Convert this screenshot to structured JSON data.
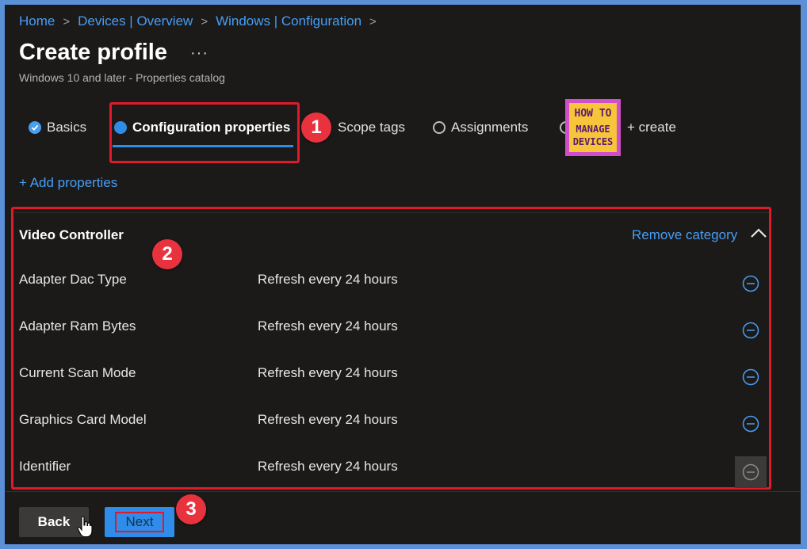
{
  "breadcrumb": {
    "items": [
      "Home",
      "Devices | Overview",
      "Windows | Configuration"
    ],
    "separator": ">"
  },
  "header": {
    "title": "Create profile",
    "more": "···",
    "subtitle": "Windows 10 and later - Properties catalog"
  },
  "wizard": {
    "steps": [
      {
        "label": "Basics",
        "state": "completed"
      },
      {
        "label": "Configuration properties",
        "state": "active"
      },
      {
        "label": "Scope tags",
        "state": "pending"
      },
      {
        "label": "Assignments",
        "state": "pending"
      },
      {
        "label": "+ create",
        "state": "pending"
      }
    ]
  },
  "badges": [
    "1",
    "2",
    "3"
  ],
  "logo": {
    "line1": "HOW TO",
    "line2": "MANAGE",
    "line3": "DEVICES"
  },
  "add_properties": "+ Add properties",
  "category": {
    "title": "Video Controller",
    "remove_label": "Remove category",
    "rows": [
      {
        "name": "Adapter Dac Type",
        "value": "Refresh every 24 hours"
      },
      {
        "name": "Adapter Ram Bytes",
        "value": "Refresh every 24 hours"
      },
      {
        "name": "Current Scan Mode",
        "value": "Refresh every 24 hours"
      },
      {
        "name": "Graphics Card Model",
        "value": "Refresh every 24 hours"
      },
      {
        "name": "Identifier",
        "value": "Refresh every 24 hours"
      }
    ]
  },
  "footer": {
    "back_label": "Back",
    "next_label": "Next"
  },
  "colors": {
    "accent": "#2f8ce8",
    "link": "#479ef5",
    "highlight": "#e11a2b",
    "background": "#1b1a19"
  },
  "icons": [
    "check-icon",
    "ellipsis-icon",
    "chevron-up-icon",
    "remove-circle-icon",
    "hand-cursor-icon"
  ]
}
